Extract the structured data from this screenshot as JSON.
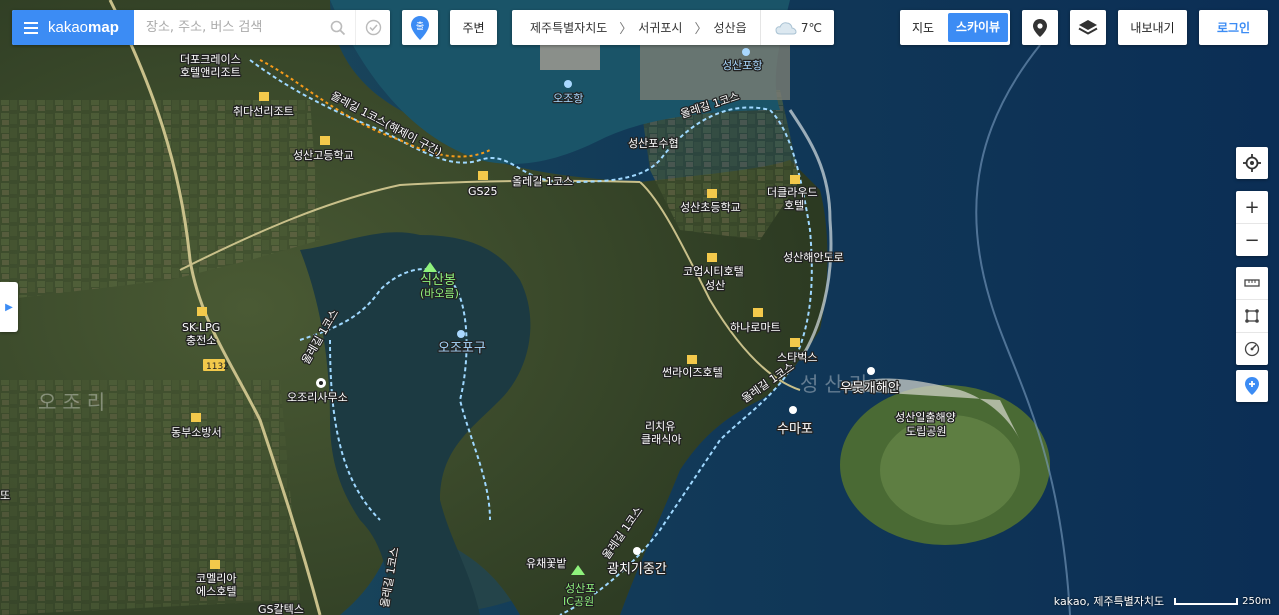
{
  "header": {
    "brand_light": "kakao",
    "brand_bold": "map",
    "search_placeholder": "장소, 주소, 버스 검색",
    "start_label": "출",
    "nearby_label": "주변",
    "breadcrumb": [
      "제주특별자치도",
      "서귀포시",
      "성산읍"
    ],
    "weather_temp": "7℃",
    "map_toggle": {
      "map": "지도",
      "skyview": "스카이뷰",
      "active": "스카이뷰"
    },
    "export_label": "내보내기",
    "login_label": "로그인"
  },
  "map_labels": {
    "resort1": "더포크레이스",
    "resort1b": "호텔앤리조트",
    "resort2": "취다선리조트",
    "school1": "성산고등학교",
    "gs25": "GS25",
    "ojo_port": "오조항",
    "seongsan_port": "성산포항",
    "seongsanpo_fish": "성산포수협",
    "olle1": "올레길 1코스(해제이 구간)",
    "olle2": "올레길 1코스",
    "olle3": "올레길 1코스",
    "olle4": "올레길 1코스",
    "olle5": "올레길 1코스",
    "olle6": "올레길 1코스",
    "olle7": "올레길 1코스",
    "school2": "성산초등학교",
    "hotel_cloud": "더클라우드",
    "hotel_cloud2": "호텔",
    "coastal_road": "성산해안도로",
    "coupcity": "코업시티호텔",
    "coupcity2": "성산",
    "hanaro": "하나로마트",
    "starbucks": "스타벅스",
    "sikk": "식산봉",
    "sikk2": "(바오름)",
    "ojopogu": "오조포구",
    "sk_lpg": "SK-LPG",
    "sk_lpg2": "충전소",
    "route": "1132",
    "ojori": "오조리",
    "ojori_office": "오조리사무소",
    "dongbu": "동부소방서",
    "sunrise": "썬라이즈호텔",
    "richwood": "리치유",
    "richwood2": "클래식아",
    "sumapo": "수마포",
    "umut": "우뭇개해안",
    "seongsan": "성산리",
    "peak": "성산일출해양",
    "peak2": "도립공원",
    "ddo": "또",
    "yuchae": "유채꽃밭",
    "gwangchi": "광치기중간",
    "seongsanpo_ic": "성산포",
    "seongsanpo_ic2": "IC공원",
    "comelia": "코멜리아",
    "comelia2": "에스호텔",
    "gs_station": "GS칼텍스"
  },
  "footer": {
    "attribution": "kakao, 제주특별자치도",
    "scale": "250m"
  }
}
